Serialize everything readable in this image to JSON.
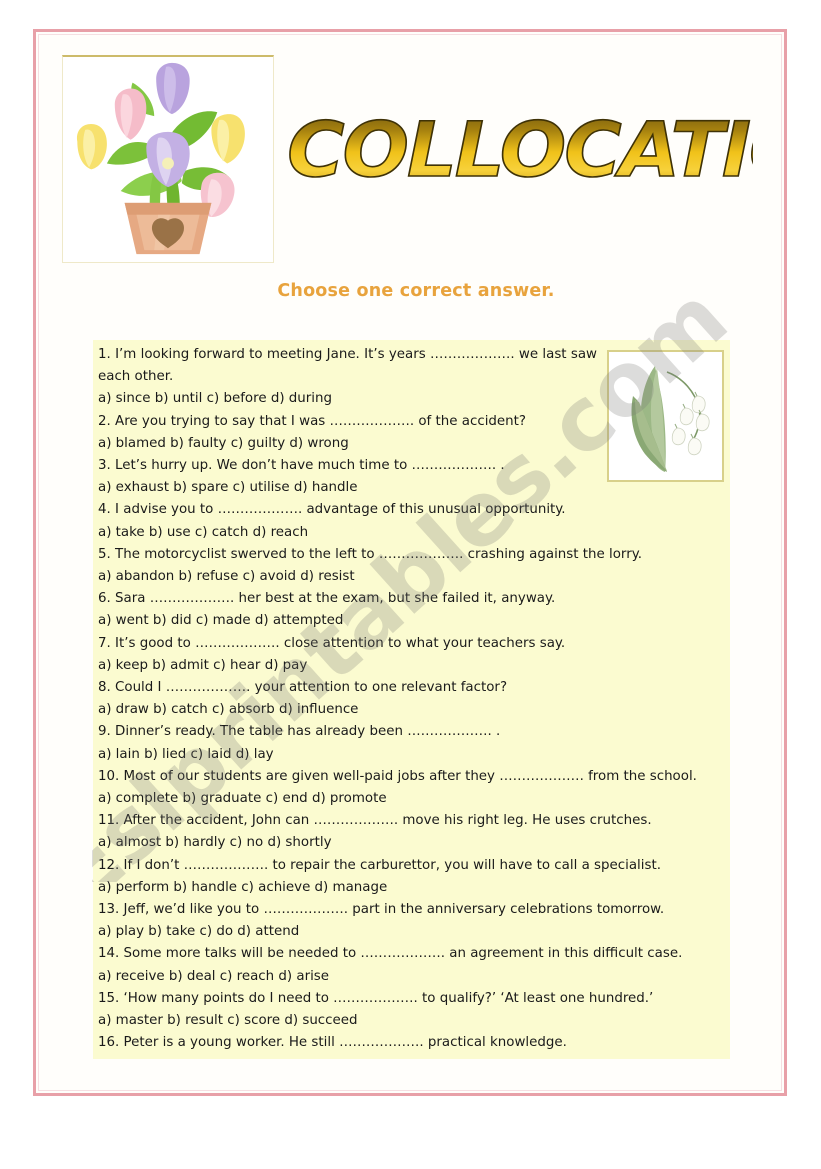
{
  "page": {
    "title": "COLLOCATIONS",
    "instruction": "Choose one correct answer.",
    "watermark": "Eslprintables.com",
    "frame_color": "#e8a0a8",
    "exercise_bg": "#fbfbd0",
    "instruction_color": "#e8a33d",
    "title_colors": {
      "light": "#f2c21a",
      "dark": "#6d5410",
      "outline": "#4a3a08"
    }
  },
  "images": {
    "header_clipart": "tulips-in-pot-image",
    "side_clipart": "lily-of-the-valley-image"
  },
  "exercise": {
    "items": [
      {
        "number": "1.",
        "question": "1. I’m looking forward to meeting Jane. It’s years ………………. we last saw each other.",
        "options": "a) since          b) until                    c) before      d) during"
      },
      {
        "number": "2.",
        "question": "2. Are you trying to say that I was ………………. of the accident?",
        "options": "a) blamed    b) faulty      c) guilty        d) wrong"
      },
      {
        "number": "3.",
        "question": "3. Let’s hurry up. We don’t have much time to ………………. .",
        "options": "a) exhaust   b) spare                  c) utilise       d) handle"
      },
      {
        "number": "4.",
        "question": "4. I advise you to ………………. advantage of this unusual opportunity.",
        "options": "a) take                 b) use                     c) catch      d) reach"
      },
      {
        "number": "5.",
        "question": "5. The motorcyclist swerved to the left to ………………. crashing against the lorry.",
        "options": "a) abandon  b) refuse     c) avoid        d) resist"
      },
      {
        "number": "6.",
        "question": "6. Sara ………………. her best at the exam, but she failed it, anyway.",
        "options": "a) went          b) did                  c) made      d) attempted"
      },
      {
        "number": "7.",
        "question": "7. It’s good to ………………. close attention to what your teachers say.",
        "options": "a) keep         b) admit                  c) hear              d) pay"
      },
      {
        "number": "8.",
        "question": "8. Could I ………………. your attention to one relevant factor?",
        "options": "a) draw       b) catch      c) absorb     d) influence"
      },
      {
        "number": "9.",
        "question": "9. Dinner’s ready. The table has already been ………………. .",
        "options": "a) lain                  b) lied                    c) laid                  d) lay"
      },
      {
        "number": "10.",
        "question": "10. Most of our students are given well-paid jobs after they ………………. from the school.",
        "options": "a) complete b) graduate            c) end                 d) promote"
      },
      {
        "number": "11.",
        "question": "11. After the accident, John can ………………. move his right leg. He uses crutches.",
        "options": "a) almost    b) hardly     c) no           d) shortly"
      },
      {
        "number": "12.",
        "question": "12. If I don’t ………………. to repair the carburettor, you will have to call a specialist.",
        "options": "a) perform   b) handle     c) achieve   d) manage"
      },
      {
        "number": "13.",
        "question": "13. Jeff, we’d like you to ………………. part in the anniversary celebrations tomorrow.",
        "options": "a) play                 b) take                  c) do          d) attend"
      },
      {
        "number": "14.",
        "question": "14. Some more talks will be needed to ………………. an agreement in this difficult case.",
        "options": "a) receive   b) deal                 c) reach      d) arise"
      },
      {
        "number": "15.",
        "question": "15. ‘How many points do I need to ………………. to qualify?’ ‘At least one hundred.’",
        "options": "a) master   b) result      c) score      d) succeed"
      },
      {
        "number": "16.",
        "question": "16. Peter is a young worker. He still ………………. practical knowledge.",
        "options": ""
      }
    ]
  }
}
